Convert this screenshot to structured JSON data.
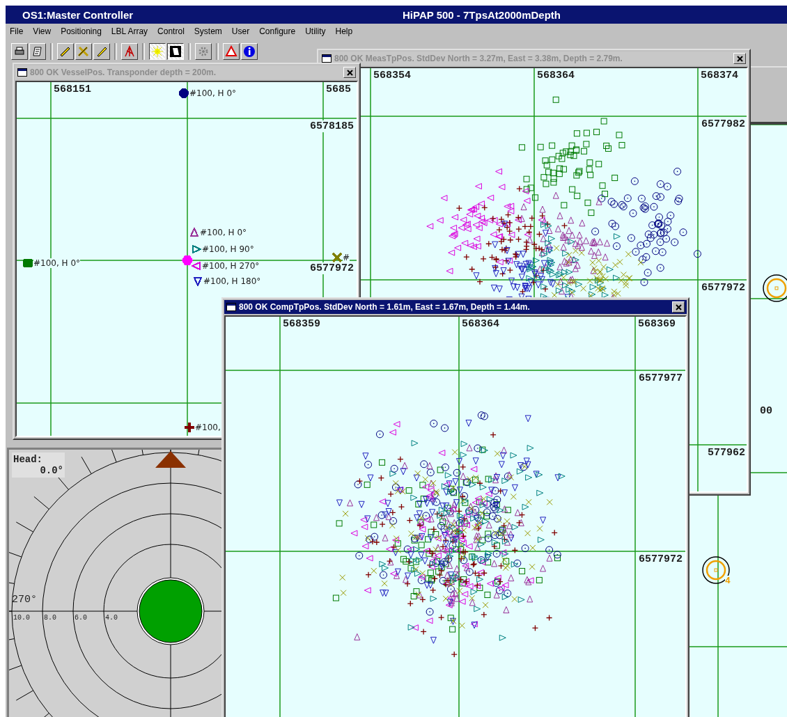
{
  "app_window": {
    "title": "OS1:Master Controller",
    "subtitle": "HiPAP 500 - 7TpsAt2000mDepth"
  },
  "menu": [
    "File",
    "View",
    "Positioning",
    "LBL Array",
    "Control",
    "System",
    "User",
    "Configure",
    "Utility",
    "Help"
  ],
  "toolbar": [
    {
      "selected": false
    },
    {
      "selected": false
    },
    {
      "selected": false
    },
    {
      "selected": false
    },
    {
      "selected": false
    },
    {
      "selected": false
    },
    {
      "selected": true
    },
    {
      "selected": true
    },
    {
      "selected": false
    },
    {
      "selected": false
    },
    {
      "selected": false
    }
  ],
  "background_map": {
    "edge_label": "00",
    "targets": [
      {
        "kind": "unlabeled"
      },
      {
        "kind": "labeled",
        "label": "4"
      }
    ]
  },
  "meas_tp_pos": {
    "title": "800 OK MeasTpPos.  StdDev North = 3.27m, East = 3.38m, Depth = 2.79m.",
    "active": false,
    "x_labels": [
      "568354",
      "568364",
      "568374"
    ],
    "y_labels": [
      "6577982",
      "6577972",
      "577962"
    ]
  },
  "vessel_pos": {
    "title": "800 OK VesselPos.  Transponder depth = 200m.",
    "active": false,
    "x_labels": [
      "568151",
      "5685"
    ],
    "y_labels": [
      "6578185",
      "6577972"
    ],
    "markers": [
      {
        "kind": "dot",
        "color": "#000080",
        "label": "#100, H 0°"
      },
      {
        "kind": "square",
        "color": "#007a00",
        "label": "#100, H 0°"
      },
      {
        "kind": "hexagon",
        "color": "#ff00ff"
      },
      {
        "kind": "up",
        "color": "#993399",
        "label": "#100, H 0°"
      },
      {
        "kind": "right",
        "color": "#008080",
        "label": "#100, H 90°"
      },
      {
        "kind": "left",
        "color": "#dd00dd",
        "label": "#100, H 270°"
      },
      {
        "kind": "down",
        "color": "#2020c0",
        "label": "#100, H 180°"
      },
      {
        "kind": "cross",
        "color": "#808000",
        "label": "#"
      },
      {
        "kind": "plus",
        "color": "#800000",
        "label": "#100,"
      }
    ]
  },
  "heading": {
    "label": "Head:",
    "value": "0.0°",
    "bearing_label": "270°",
    "ring_labels": [
      "10.0",
      "8.0",
      "6.0",
      "4.0"
    ]
  },
  "comp_tp_pos": {
    "title": "800 OK CompTpPos.  StdDev North = 1.61m, East = 1.67m, Depth = 1.44m.",
    "active": true,
    "x_labels": [
      "568359",
      "568364",
      "568369"
    ],
    "y_labels": [
      "6577977",
      "6577972"
    ]
  }
}
